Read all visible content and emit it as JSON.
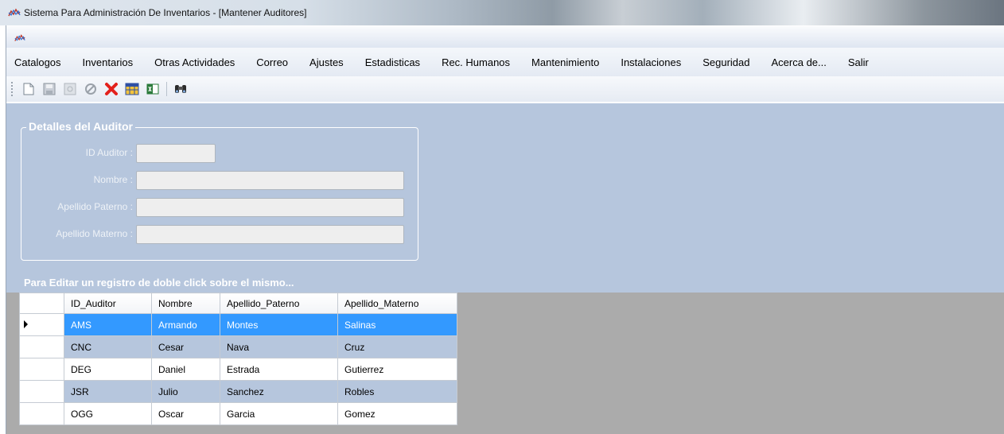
{
  "window": {
    "title": "Sistema Para Administración De Inventarios - [Mantener Auditores]"
  },
  "menu": [
    "Catalogos",
    "Inventarios",
    "Otras Actividades",
    "Correo",
    "Ajustes",
    "Estadisticas",
    "Rec. Humanos",
    "Mantenimiento",
    "Instalaciones",
    "Seguridad",
    "Acerca de...",
    "Salir"
  ],
  "toolbar": {
    "icons": [
      "new-document-icon",
      "save-icon",
      "save-disabled-icon",
      "cancel-icon",
      "delete-icon",
      "table-icon",
      "excel-export-icon",
      "binoculars-search-icon"
    ]
  },
  "details": {
    "legend": "Detalles del Auditor",
    "fields": [
      {
        "label": "ID Auditor :",
        "value": ""
      },
      {
        "label": "Nombre :",
        "value": ""
      },
      {
        "label": "Apellido Paterno :",
        "value": ""
      },
      {
        "label": "Apellido Materno :",
        "value": ""
      }
    ]
  },
  "hint": "Para Editar un registro de doble click sobre el mismo...",
  "grid": {
    "columns": [
      "ID_Auditor",
      "Nombre",
      "Apellido_Paterno",
      "Apellido_Materno"
    ],
    "rows": [
      [
        "AMS",
        "Armando",
        "Montes",
        "Salinas"
      ],
      [
        "CNC",
        "Cesar",
        "Nava",
        "Cruz"
      ],
      [
        "DEG",
        "Daniel",
        "Estrada",
        "Gutierrez"
      ],
      [
        "JSR",
        "Julio",
        "Sanchez",
        "Robles"
      ],
      [
        "OGG",
        "Oscar",
        "Garcia",
        "Gomez"
      ]
    ],
    "selected_row": 0
  },
  "colors": {
    "panel_bg": "#b6c6dd",
    "selection": "#3399ff",
    "grid_bg": "#ababab"
  }
}
